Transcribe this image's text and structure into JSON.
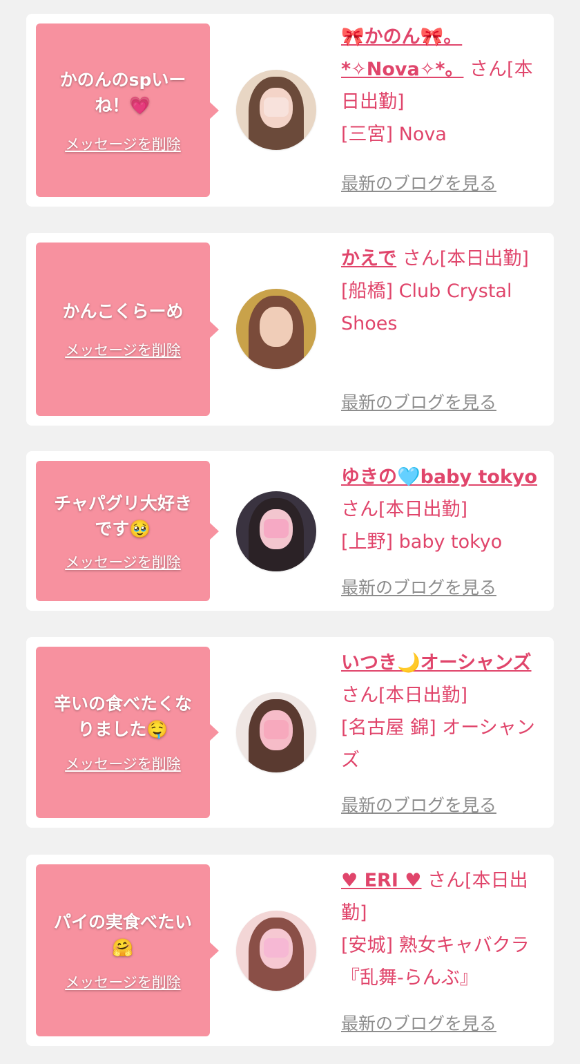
{
  "cards": [
    {
      "message": "かのんのspいーね！💗",
      "delete_label": "メッセージを削除",
      "name": "🎀かのん🎀。*✧Nova✧*。",
      "suffix": "さん[本日出勤]",
      "location": "[三宮] Nova",
      "blog_label": "最新のブログを見る",
      "avatar_colors": [
        "#e8d6c4",
        "#6b4a3a",
        "#f4d4c8"
      ]
    },
    {
      "message": "かんこくらーめ",
      "delete_label": "メッセージを削除",
      "name": "かえで",
      "suffix": "さん[本日出勤]",
      "location": "[船橋] Club Crystal Shoes",
      "blog_label": "最新のブログを見る",
      "avatar_colors": [
        "#c9a24a",
        "#7a4b3a",
        "#f0cdb8"
      ]
    },
    {
      "message": "チャパグリ大好きです🥹",
      "delete_label": "メッセージを削除",
      "name": "ゆきの🩵baby tokyo",
      "suffix": "さん[本日出勤]",
      "location": "[上野] baby tokyo",
      "blog_label": "最新のブログを見る",
      "avatar_colors": [
        "#3a3340",
        "#2b2226",
        "#f3c6cf"
      ]
    },
    {
      "message": "辛いの食べたくなりました🤤",
      "delete_label": "メッセージを削除",
      "name": "いつき🌙オーシャンズ",
      "suffix": "さん[本日出勤]",
      "location": "[名古屋 錦] オーシャンズ",
      "blog_label": "最新のブログを見る",
      "avatar_colors": [
        "#efe6e3",
        "#5a3a30",
        "#f6bcc8"
      ]
    },
    {
      "message": "パイの実食べたい🤗",
      "delete_label": "メッセージを削除",
      "name": "♥ ERI ♥",
      "suffix": "さん[本日出勤]",
      "location": "[安城] 熟女キャバクラ『乱舞-らんぶ』",
      "blog_label": "最新のブログを見る",
      "avatar_colors": [
        "#f3d6d6",
        "#8a4f47",
        "#f6c8d2"
      ]
    }
  ]
}
